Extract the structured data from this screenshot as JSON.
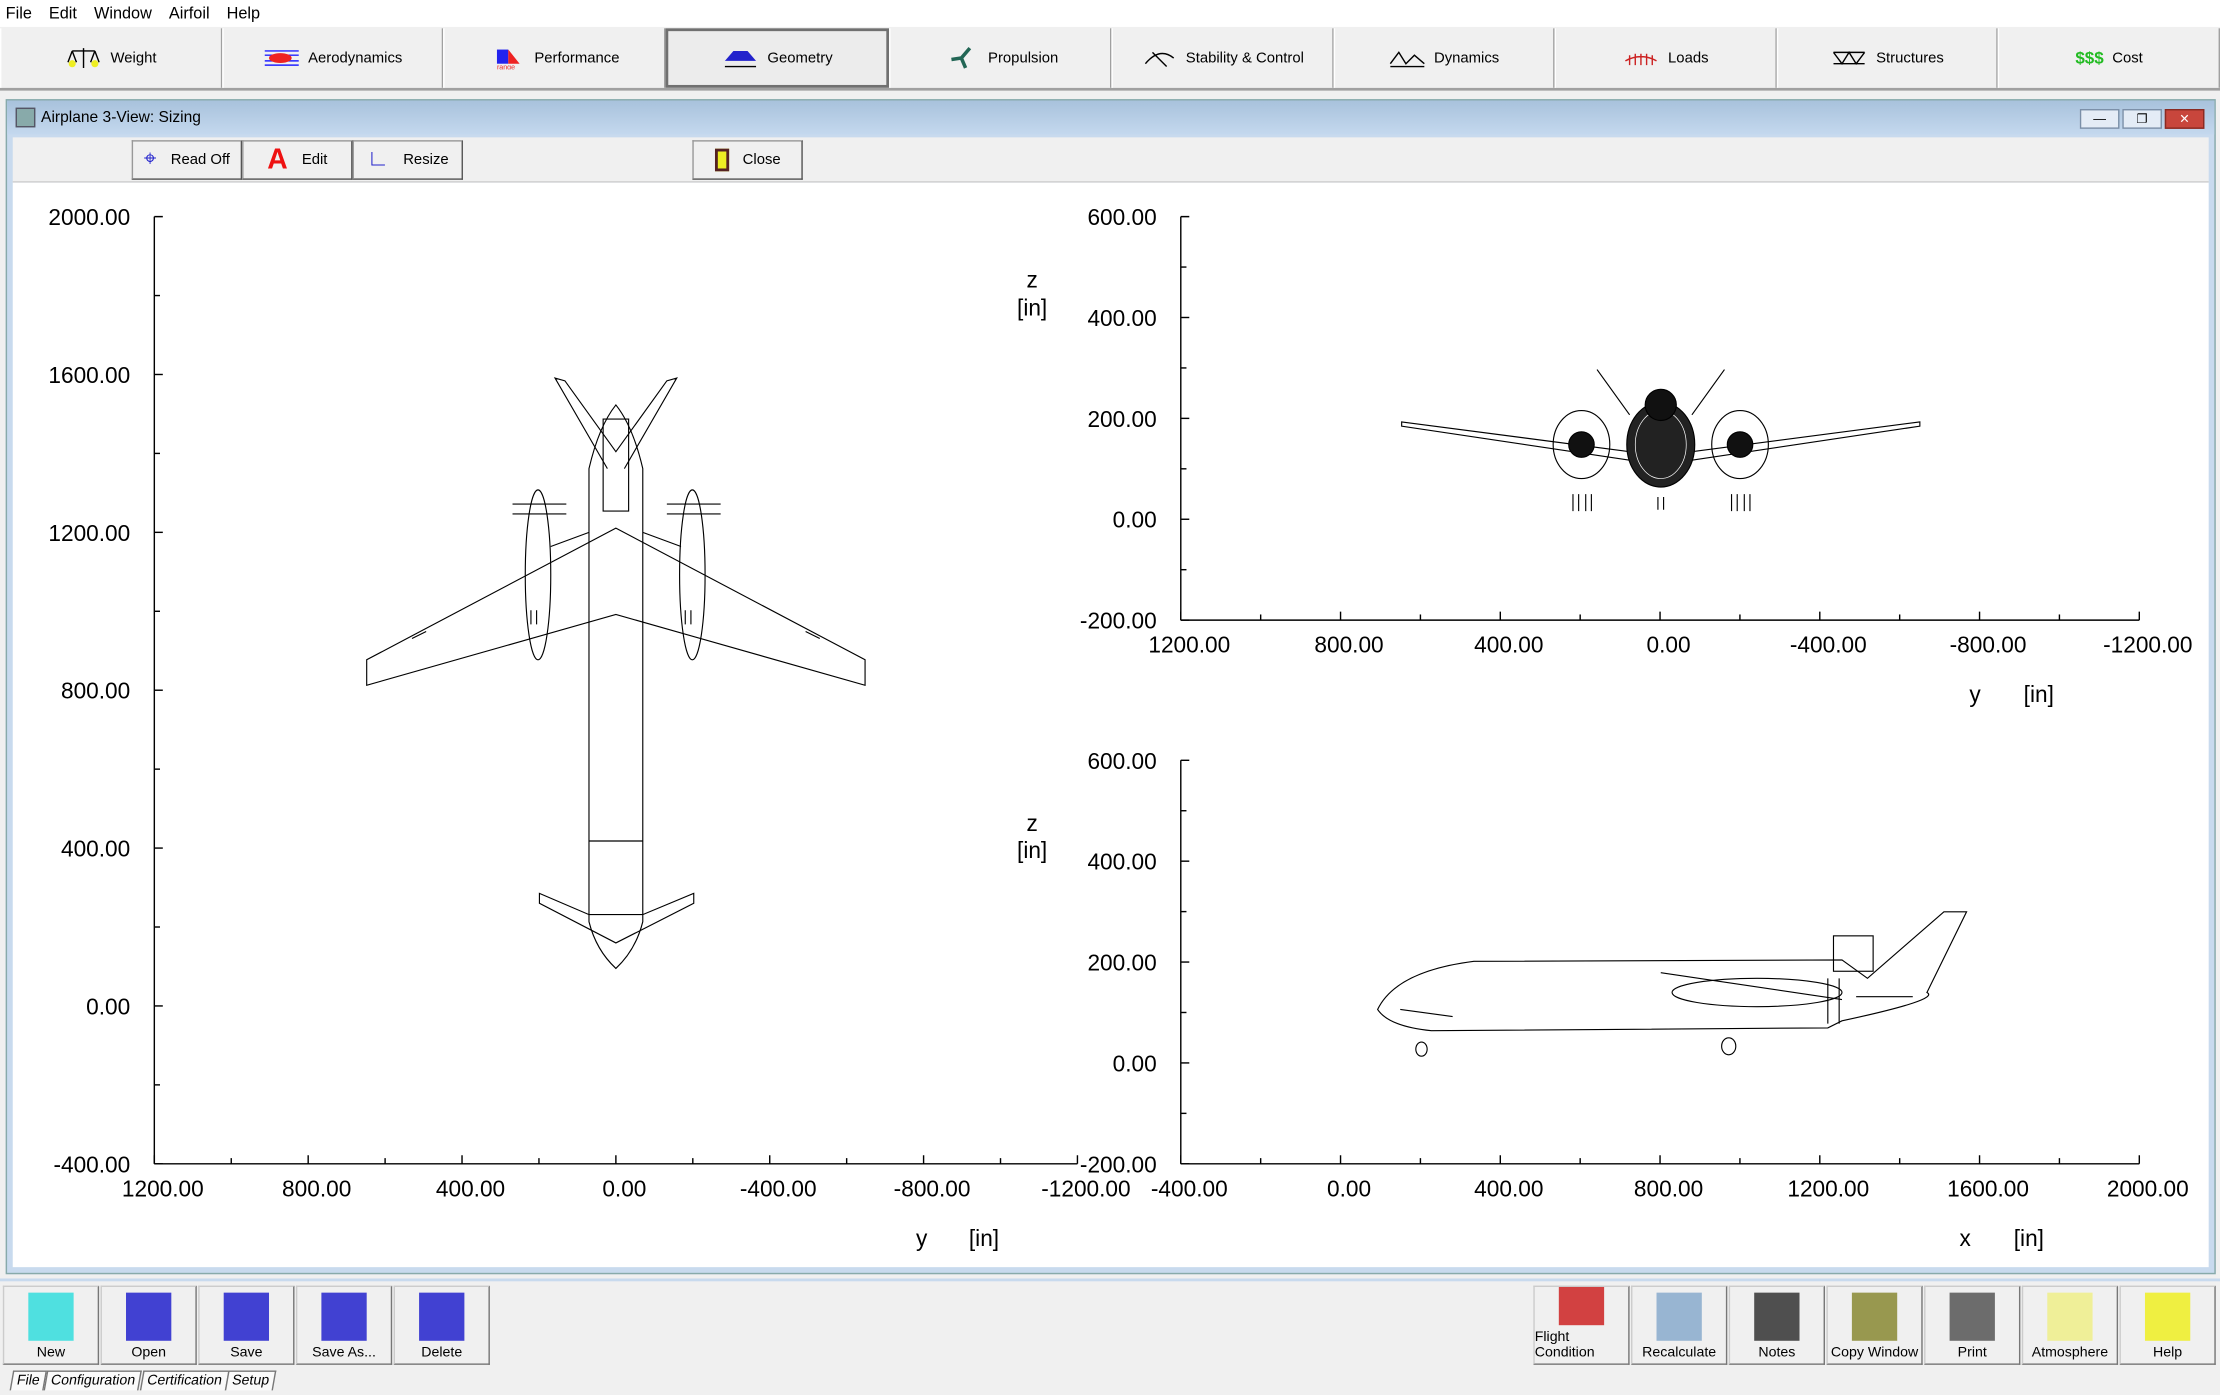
{
  "menu": [
    "File",
    "Edit",
    "Window",
    "Airfoil",
    "Help"
  ],
  "tools": [
    {
      "label": "Weight",
      "icon": "scale-icon"
    },
    {
      "label": "Aerodynamics",
      "icon": "airflow-icon"
    },
    {
      "label": "Performance",
      "icon": "performance-icon"
    },
    {
      "label": "Geometry",
      "icon": "wing-geometry-icon",
      "active": true
    },
    {
      "label": "Propulsion",
      "icon": "propeller-icon"
    },
    {
      "label": "Stability & Control",
      "icon": "stability-icon"
    },
    {
      "label": "Dynamics",
      "icon": "dynamics-icon"
    },
    {
      "label": "Loads",
      "icon": "loads-icon"
    },
    {
      "label": "Structures",
      "icon": "structures-icon"
    },
    {
      "label": "Cost",
      "icon": "cost-icon",
      "icon_text": "$$$"
    }
  ],
  "window": {
    "title": "Airplane 3-View: Sizing",
    "buttons": {
      "read_off": "Read Off",
      "edit": "Edit",
      "resize": "Resize",
      "close": "Close"
    },
    "edit_icon_text": "A"
  },
  "views": {
    "top": {
      "x_ticks": [
        "1200.00",
        "800.00",
        "400.00",
        "0.00",
        "-400.00",
        "-800.00",
        "-1200.00"
      ],
      "y_ticks": [
        "2000.00",
        "1600.00",
        "1200.00",
        "800.00",
        "400.00",
        "0.00",
        "-400.00"
      ],
      "xlabel": "y",
      "xunit": "[in]",
      "ylabel": "z",
      "yunit": "[in]",
      "xlim": [
        1200,
        -1200
      ],
      "ylim": [
        -400,
        2000
      ]
    },
    "front": {
      "x_ticks": [
        "1200.00",
        "800.00",
        "400.00",
        "0.00",
        "-400.00",
        "-800.00",
        "-1200.00"
      ],
      "y_ticks": [
        "600.00",
        "400.00",
        "200.00",
        "0.00",
        "-200.00"
      ],
      "xlabel": "y",
      "xunit": "[in]",
      "xlim": [
        1200,
        -1200
      ],
      "ylim": [
        -200,
        600
      ]
    },
    "side": {
      "x_ticks": [
        "-400.00",
        "0.00",
        "400.00",
        "800.00",
        "1200.00",
        "1600.00",
        "2000.00"
      ],
      "y_ticks": [
        "600.00",
        "400.00",
        "200.00",
        "0.00",
        "-200.00"
      ],
      "xlabel": "x",
      "xunit": "[in]",
      "ylabel": "z",
      "yunit": "[in]",
      "xlim": [
        -400,
        2000
      ],
      "ylim": [
        -200,
        600
      ]
    }
  },
  "bottom_left": [
    "New",
    "Open",
    "Save",
    "Save As...",
    "Delete"
  ],
  "bottom_right": [
    "Flight Condition",
    "Recalculate",
    "Notes",
    "Copy Window",
    "Print",
    "Atmosphere",
    "Help"
  ],
  "bottom_tabs": [
    "File",
    "Configuration",
    "Certification",
    "Setup"
  ],
  "colors": {
    "title_bar": "#a8c2dc",
    "close_button": "#c8463c",
    "cost_green": "#22bb22"
  }
}
